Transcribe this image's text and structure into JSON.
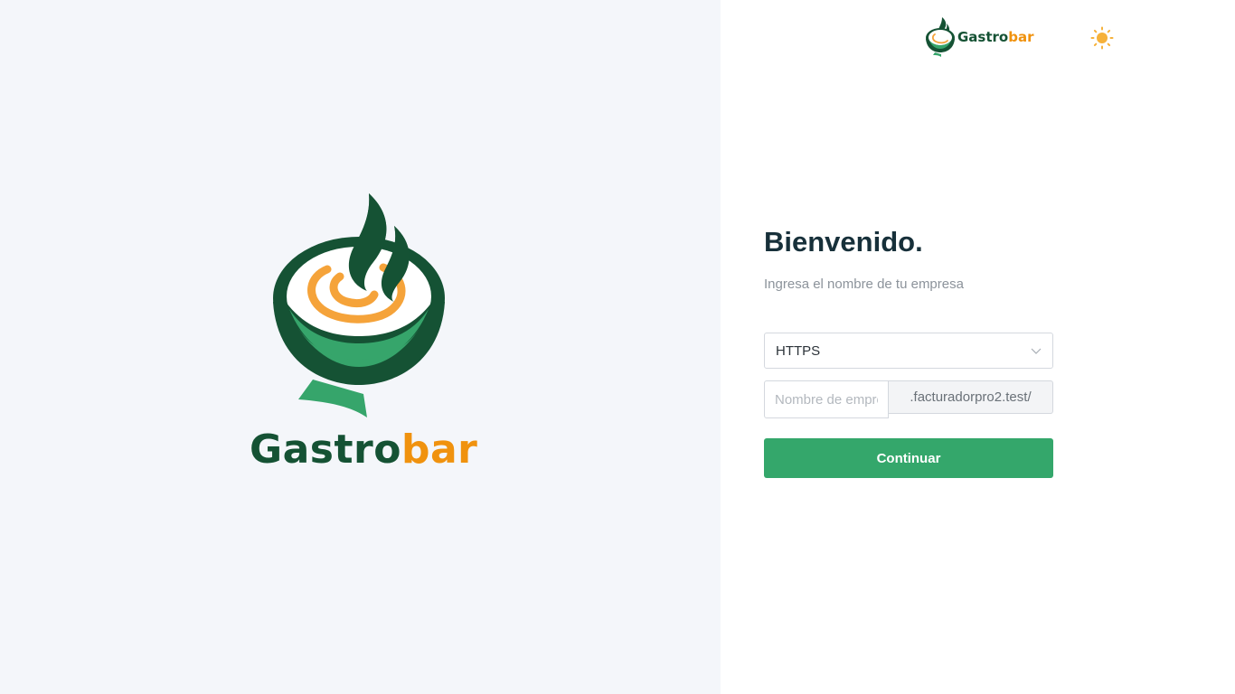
{
  "brand": {
    "name_part1": "Gastro",
    "name_part2": "bar",
    "colors": {
      "dark_green": "#155234",
      "green": "#34a76b",
      "orange": "#f0920e",
      "sun": "#f6b13a"
    }
  },
  "header": {
    "theme_toggle_icon": "sun-icon"
  },
  "login": {
    "title": "Bienvenido.",
    "subtitle": "Ingresa el nombre de tu empresa",
    "protocol": {
      "selected": "HTTPS"
    },
    "company_field": {
      "placeholder": "Nombre de empresa",
      "value": ""
    },
    "domain_suffix": ".facturadorpro2.test/",
    "continue_label": "Continuar"
  }
}
